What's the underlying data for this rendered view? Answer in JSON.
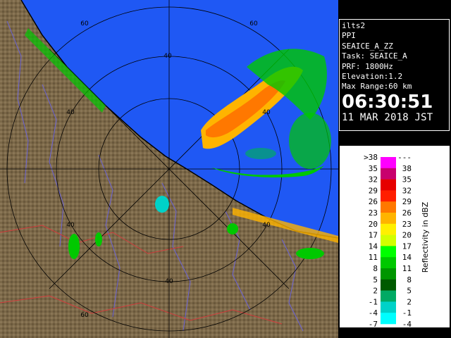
{
  "info": {
    "site": "ilts2",
    "product": "PPI",
    "variable": "SEAICE_A_ZZ",
    "task": "Task: SEAICE_A",
    "prf": "PRF: 1800Hz",
    "elevation": "Elevation:1.2",
    "max_range": "Max Range:60 km",
    "time": "06:30:51",
    "date": "11 MAR 2018 JST"
  },
  "map": {
    "range_ring_labels": [
      "60",
      "60",
      "40",
      "40",
      "40",
      "40",
      "40",
      "40",
      "60"
    ],
    "colors": {
      "sea": "#1f58f4",
      "land": "#7b6848",
      "coastline": "#000000"
    }
  },
  "colorbar": {
    "title": "Reflectivity in dBZ",
    "colors": [
      "#ff00ff",
      "#c8006e",
      "#e60000",
      "#ff1e00",
      "#ff7800",
      "#ffb400",
      "#fff000",
      "#d2ff00",
      "#00ff00",
      "#00c800",
      "#009600",
      "#005a00",
      "#00aa64",
      "#00d2c8",
      "#00ffff"
    ],
    "lower_labels": [
      ">38",
      "35",
      "32",
      "29",
      "26",
      "23",
      "20",
      "17",
      "14",
      "11",
      "8",
      "5",
      "2",
      "-1",
      "-4",
      "-7"
    ],
    "upper_labels": [
      "---",
      "38",
      "35",
      "32",
      "29",
      "26",
      "23",
      "20",
      "17",
      "14",
      "11",
      "8",
      "5",
      "2",
      "-1",
      "-4"
    ]
  }
}
